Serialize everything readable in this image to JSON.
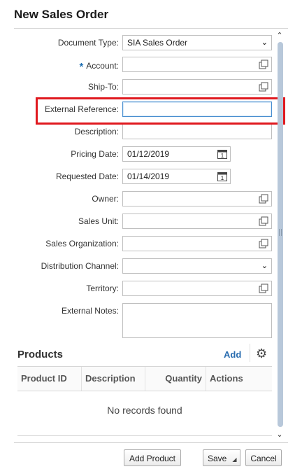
{
  "dialog": {
    "title": "New Sales Order"
  },
  "form": {
    "document_type": {
      "label": "Document Type:",
      "value": "SIA Sales Order"
    },
    "account": {
      "required_mark": "*",
      "label": "Account:",
      "value": ""
    },
    "ship_to": {
      "label": "Ship-To:",
      "value": ""
    },
    "external_reference": {
      "label": "External Reference:",
      "value": ""
    },
    "description": {
      "label": "Description:",
      "value": ""
    },
    "pricing_date": {
      "label": "Pricing Date:",
      "value": "01/12/2019"
    },
    "requested_date": {
      "label": "Requested Date:",
      "value": "01/14/2019"
    },
    "owner": {
      "label": "Owner:",
      "value": ""
    },
    "sales_unit": {
      "label": "Sales Unit:",
      "value": ""
    },
    "sales_organization": {
      "label": "Sales Organization:",
      "value": ""
    },
    "distribution_channel": {
      "label": "Distribution Channel:",
      "value": ""
    },
    "territory": {
      "label": "Territory:",
      "value": ""
    },
    "external_notes": {
      "label": "External Notes:",
      "value": ""
    }
  },
  "products": {
    "title": "Products",
    "add_label": "Add",
    "columns": [
      "Product ID",
      "Description",
      "Quantity",
      "Actions"
    ],
    "empty_text": "No records found"
  },
  "footer": {
    "add_product_label": "Add Product",
    "save_label": "Save",
    "cancel_label": "Cancel"
  },
  "calendar_day": "1",
  "colors": {
    "highlight": "#e0191f",
    "link": "#2a6db0",
    "required": "#1f6fb2",
    "scrollbar": "#b8c8da"
  }
}
